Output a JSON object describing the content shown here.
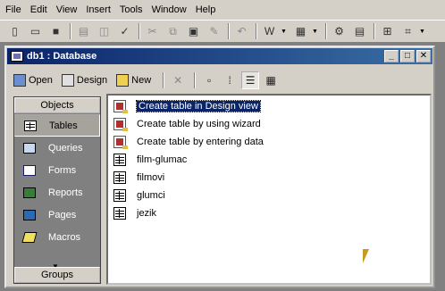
{
  "app": {
    "menus": [
      "File",
      "Edit",
      "View",
      "Insert",
      "Tools",
      "Window",
      "Help"
    ]
  },
  "window": {
    "title": "db1 : Database",
    "min_label": "_",
    "max_label": "□",
    "close_label": "✕"
  },
  "dbtoolbar": {
    "open_label": "Open",
    "design_label": "Design",
    "new_label": "New"
  },
  "objects": {
    "header": "Objects",
    "items": [
      "Tables",
      "Queries",
      "Forms",
      "Reports",
      "Pages",
      "Macros"
    ],
    "selected": "Tables",
    "groups_label": "Groups"
  },
  "list": {
    "items": [
      {
        "label": "Create table in Design view",
        "icon": "wizard-icon",
        "selected": true
      },
      {
        "label": "Create table by using wizard",
        "icon": "wizard-icon",
        "selected": false
      },
      {
        "label": "Create table by entering data",
        "icon": "wizard-icon",
        "selected": false
      },
      {
        "label": "film-glumac",
        "icon": "table-icon",
        "selected": false
      },
      {
        "label": "filmovi",
        "icon": "table-icon",
        "selected": false
      },
      {
        "label": "glumci",
        "icon": "table-icon",
        "selected": false
      },
      {
        "label": "jezik",
        "icon": "table-icon",
        "selected": false
      }
    ]
  },
  "colors": {
    "title_active": "#0a246a",
    "selection": "#0a246a",
    "face": "#d4d0c8",
    "mdi_bg": "#808080"
  }
}
